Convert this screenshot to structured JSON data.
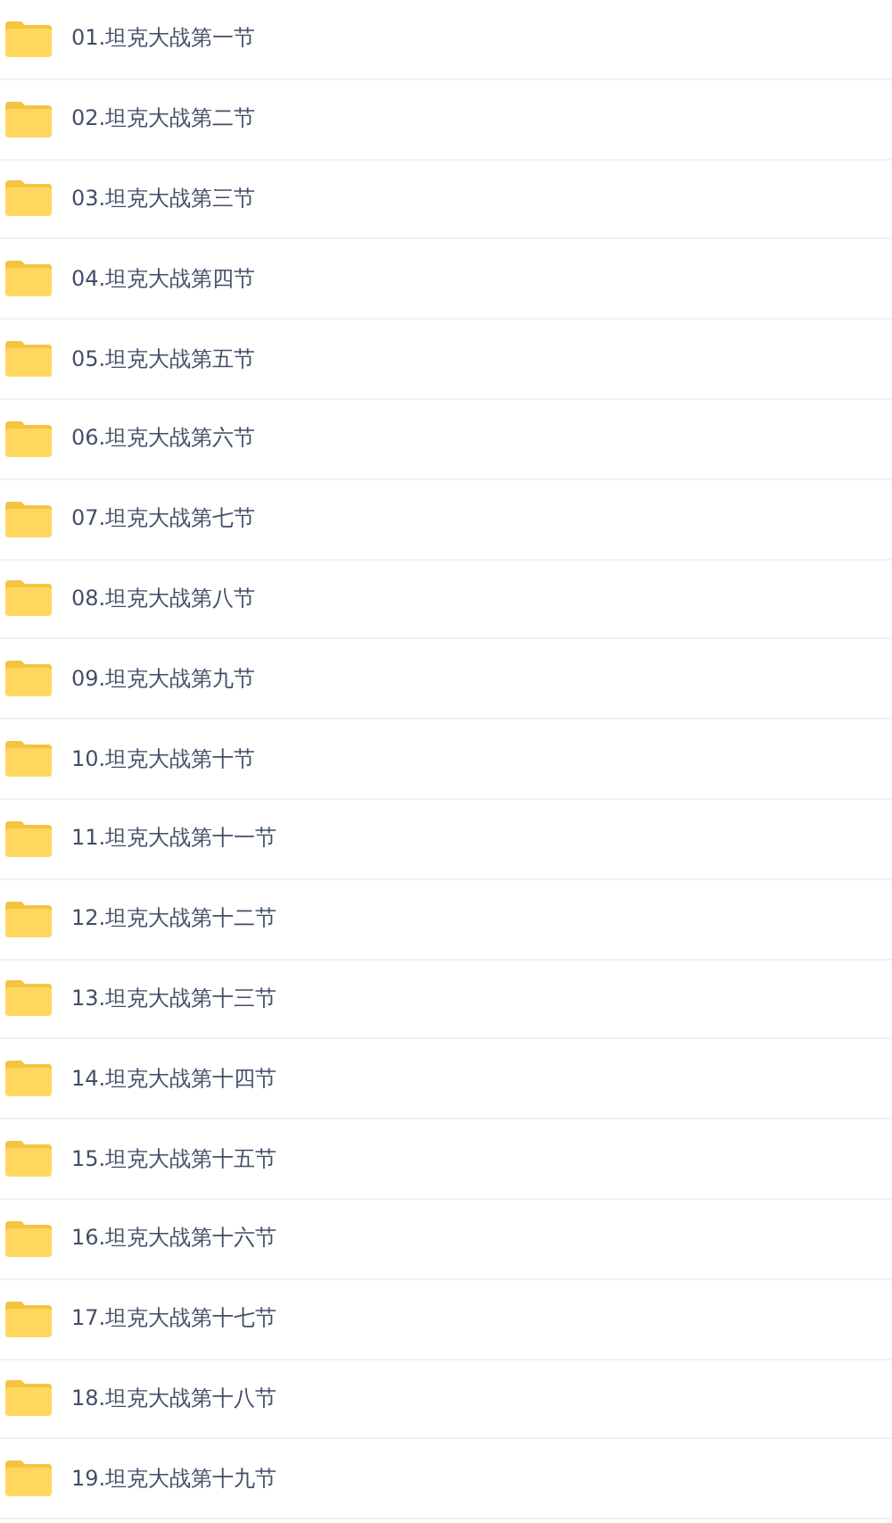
{
  "folders": [
    {
      "name": "01.坦克大战第一节"
    },
    {
      "name": "02.坦克大战第二节"
    },
    {
      "name": "03.坦克大战第三节"
    },
    {
      "name": "04.坦克大战第四节"
    },
    {
      "name": "05.坦克大战第五节"
    },
    {
      "name": "06.坦克大战第六节"
    },
    {
      "name": "07.坦克大战第七节"
    },
    {
      "name": "08.坦克大战第八节"
    },
    {
      "name": "09.坦克大战第九节"
    },
    {
      "name": "10.坦克大战第十节"
    },
    {
      "name": "11.坦克大战第十一节"
    },
    {
      "name": "12.坦克大战第十二节"
    },
    {
      "name": "13.坦克大战第十三节"
    },
    {
      "name": "14.坦克大战第十四节"
    },
    {
      "name": "15.坦克大战第十五节"
    },
    {
      "name": "16.坦克大战第十六节"
    },
    {
      "name": "17.坦克大战第十七节"
    },
    {
      "name": "18.坦克大战第十八节"
    },
    {
      "name": "19.坦克大战第十九节"
    }
  ]
}
